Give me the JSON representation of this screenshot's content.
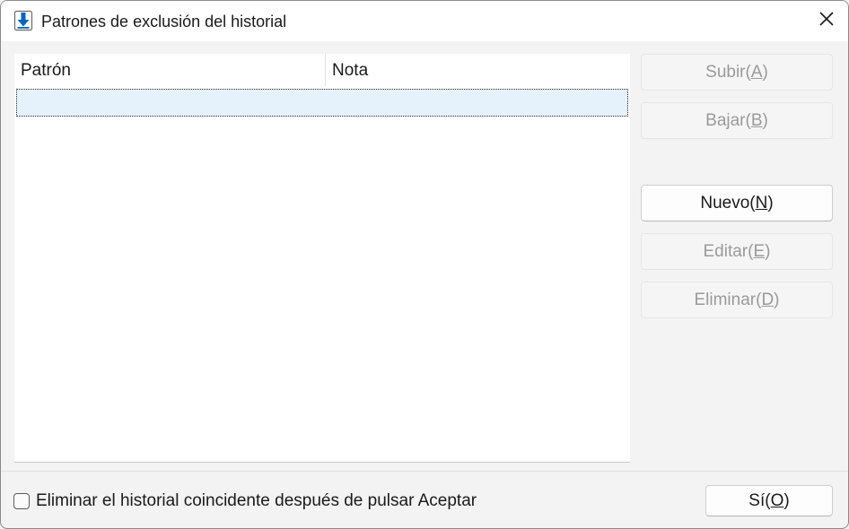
{
  "window": {
    "title": "Patrones de exclusión del historial",
    "icon": "download-arrow-icon"
  },
  "list": {
    "columns": [
      "Patrón",
      "Nota"
    ],
    "rows": [
      {
        "pattern": "",
        "note": "",
        "selected": true
      }
    ]
  },
  "buttons": {
    "up": {
      "prefix": "Subir(",
      "mnemonic": "A",
      "suffix": ")",
      "enabled": false
    },
    "down": {
      "prefix": "Bajar(",
      "mnemonic": "B",
      "suffix": ")",
      "enabled": false
    },
    "new": {
      "prefix": "Nuevo(",
      "mnemonic": "N",
      "suffix": ")",
      "enabled": true
    },
    "edit": {
      "prefix": "Editar(",
      "mnemonic": "E",
      "suffix": ")",
      "enabled": false
    },
    "delete": {
      "prefix": "Eliminar(",
      "mnemonic": "D",
      "suffix": ")",
      "enabled": false
    },
    "ok": {
      "prefix": "Sí(",
      "mnemonic": "O",
      "suffix": ")",
      "enabled": true
    }
  },
  "checkbox": {
    "label": "Eliminar el historial coincidente después de pulsar Aceptar",
    "checked": false
  },
  "colors": {
    "accent": "#0067c0",
    "selection": "#e5f1fb"
  }
}
